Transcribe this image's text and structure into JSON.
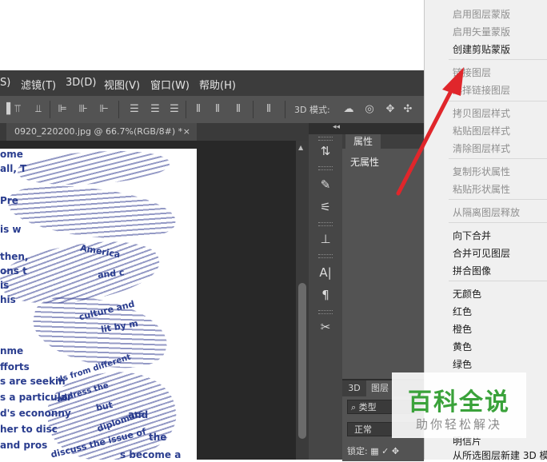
{
  "menubar": {
    "items": [
      {
        "label": "S)"
      },
      {
        "label": "滤镜(T)"
      },
      {
        "label": "3D(D)"
      },
      {
        "label": "视图(V)"
      },
      {
        "label": "窗口(W)"
      },
      {
        "label": "帮助(H)"
      }
    ]
  },
  "options_bar": {
    "mode_label": "3D 模式:"
  },
  "document": {
    "tab_title": "0920_220200.jpg @ 66.7%(RGB/8#) *",
    "close_glyph": "×",
    "text_lines": [
      "ome",
      "all, T",
      "Pre",
      "is w",
      "then,",
      "ons t",
      "is",
      "his",
      "nme",
      "fforts",
      "s are seekin",
      "s a particular",
      "d's econonny",
      "her to disc",
      "and pros",
      "the",
      "s become a"
    ],
    "warped_text": [
      "America",
      "and c",
      "culture and",
      "lit by m",
      "ds from different",
      "address the",
      "diplomats",
      "and",
      "but",
      "discuss the issue of"
    ]
  },
  "panels": {
    "properties": {
      "tab_label": "属性",
      "value": "无属性"
    },
    "layers": {
      "tabs": [
        "3D",
        "图层"
      ],
      "filter_label": "类型",
      "blend_mode": "正常",
      "lock_label": "锁定:"
    },
    "collapse_glyph": "◂◂",
    "tools": [
      "clone-source-icon",
      "brush-presets-icon",
      "brush-icon",
      "tool-presets-icon",
      "character-icon",
      "paragraph-icon",
      "adjustment-icon"
    ]
  },
  "context_menu": {
    "items": [
      {
        "label": "启用图层蒙版",
        "enabled": false
      },
      {
        "label": "启用矢量蒙版",
        "enabled": false
      },
      {
        "label": "创建剪贴蒙版",
        "enabled": true
      },
      {
        "label": "链接图层",
        "enabled": false
      },
      {
        "label": "选择链接图层",
        "enabled": false
      },
      {
        "label": "拷贝图层样式",
        "enabled": false
      },
      {
        "label": "粘贴图层样式",
        "enabled": false
      },
      {
        "label": "清除图层样式",
        "enabled": false
      },
      {
        "label": "复制形状属性",
        "enabled": false
      },
      {
        "label": "粘贴形状属性",
        "enabled": false
      },
      {
        "label": "从隔离图层释放",
        "enabled": false
      },
      {
        "label": "向下合并",
        "enabled": true
      },
      {
        "label": "合并可见图层",
        "enabled": true
      },
      {
        "label": "拼合图像",
        "enabled": true
      },
      {
        "label": "无颜色",
        "enabled": true
      },
      {
        "label": "红色",
        "enabled": true
      },
      {
        "label": "橙色",
        "enabled": true
      },
      {
        "label": "黄色",
        "enabled": true
      },
      {
        "label": "绿色",
        "enabled": true
      },
      {
        "label": "明信片",
        "enabled": true
      },
      {
        "label": "从所选图层新建 3D 模",
        "enabled": true
      }
    ]
  },
  "watermark": {
    "title": "百科全说",
    "subtitle": "助你轻松解决"
  },
  "colors": {
    "annotation_arrow": "#e0262b",
    "watermark_green": "#3aa23a"
  }
}
